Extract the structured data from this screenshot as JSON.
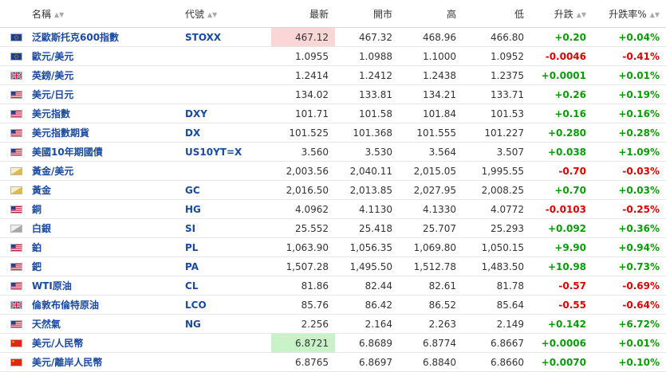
{
  "headers": {
    "name": "名稱",
    "code": "代號",
    "last": "最新",
    "open": "開市",
    "high": "高",
    "low": "低",
    "change": "升跌",
    "change_pct": "升跌率%"
  },
  "rows": [
    {
      "flag": "eu",
      "name": "泛歐斯托克600指數",
      "code": "STOXX",
      "last": "467.12",
      "open": "467.32",
      "high": "468.96",
      "low": "466.80",
      "change": "+0.20",
      "change_pct": "+0.04%",
      "dir": "up",
      "highlight": "red"
    },
    {
      "flag": "eu",
      "name": "歐元/美元",
      "code": "",
      "last": "1.0955",
      "open": "1.0988",
      "high": "1.1000",
      "low": "1.0952",
      "change": "-0.0046",
      "change_pct": "-0.41%",
      "dir": "down",
      "highlight": ""
    },
    {
      "flag": "uk",
      "name": "英鎊/美元",
      "code": "",
      "last": "1.2414",
      "open": "1.2412",
      "high": "1.2438",
      "low": "1.2375",
      "change": "+0.0001",
      "change_pct": "+0.01%",
      "dir": "up",
      "highlight": ""
    },
    {
      "flag": "us",
      "name": "美元/日元",
      "code": "",
      "last": "134.02",
      "open": "133.81",
      "high": "134.21",
      "low": "133.71",
      "change": "+0.26",
      "change_pct": "+0.19%",
      "dir": "up",
      "highlight": ""
    },
    {
      "flag": "us",
      "name": "美元指數",
      "code": "DXY",
      "last": "101.71",
      "open": "101.58",
      "high": "101.84",
      "low": "101.53",
      "change": "+0.16",
      "change_pct": "+0.16%",
      "dir": "up",
      "highlight": ""
    },
    {
      "flag": "us",
      "name": "美元指數期貨",
      "code": "DX",
      "last": "101.525",
      "open": "101.368",
      "high": "101.555",
      "low": "101.227",
      "change": "+0.280",
      "change_pct": "+0.28%",
      "dir": "up",
      "highlight": ""
    },
    {
      "flag": "us",
      "name": "美國10年期國債",
      "code": "US10YT=X",
      "last": "3.560",
      "open": "3.530",
      "high": "3.564",
      "low": "3.507",
      "change": "+0.038",
      "change_pct": "+1.09%",
      "dir": "up",
      "highlight": ""
    },
    {
      "flag": "gold",
      "name": "黃金/美元",
      "code": "",
      "last": "2,003.56",
      "open": "2,040.11",
      "high": "2,015.05",
      "low": "1,995.55",
      "change": "-0.70",
      "change_pct": "-0.03%",
      "dir": "down",
      "highlight": ""
    },
    {
      "flag": "gold",
      "name": "黃金",
      "code": "GC",
      "last": "2,016.50",
      "open": "2,013.85",
      "high": "2,027.95",
      "low": "2,008.25",
      "change": "+0.70",
      "change_pct": "+0.03%",
      "dir": "up",
      "highlight": ""
    },
    {
      "flag": "us",
      "name": "銅",
      "code": "HG",
      "last": "4.0962",
      "open": "4.1130",
      "high": "4.1330",
      "low": "4.0772",
      "change": "-0.0103",
      "change_pct": "-0.25%",
      "dir": "down",
      "highlight": ""
    },
    {
      "flag": "silver",
      "name": "白銀",
      "code": "SI",
      "last": "25.552",
      "open": "25.418",
      "high": "25.707",
      "low": "25.293",
      "change": "+0.092",
      "change_pct": "+0.36%",
      "dir": "up",
      "highlight": ""
    },
    {
      "flag": "us",
      "name": "鉑",
      "code": "PL",
      "last": "1,063.90",
      "open": "1,056.35",
      "high": "1,069.80",
      "low": "1,050.15",
      "change": "+9.90",
      "change_pct": "+0.94%",
      "dir": "up",
      "highlight": ""
    },
    {
      "flag": "us",
      "name": "鈀",
      "code": "PA",
      "last": "1,507.28",
      "open": "1,495.50",
      "high": "1,512.78",
      "low": "1,483.50",
      "change": "+10.98",
      "change_pct": "+0.73%",
      "dir": "up",
      "highlight": ""
    },
    {
      "flag": "us",
      "name": "WTI原油",
      "code": "CL",
      "last": "81.86",
      "open": "82.44",
      "high": "82.61",
      "low": "81.78",
      "change": "-0.57",
      "change_pct": "-0.69%",
      "dir": "down",
      "highlight": ""
    },
    {
      "flag": "uk",
      "name": "倫敦布倫特原油",
      "code": "LCO",
      "last": "85.76",
      "open": "86.42",
      "high": "86.52",
      "low": "85.64",
      "change": "-0.55",
      "change_pct": "-0.64%",
      "dir": "down",
      "highlight": ""
    },
    {
      "flag": "us",
      "name": "天然氣",
      "code": "NG",
      "last": "2.256",
      "open": "2.164",
      "high": "2.263",
      "low": "2.149",
      "change": "+0.142",
      "change_pct": "+6.72%",
      "dir": "up",
      "highlight": ""
    },
    {
      "flag": "cn",
      "name": "美元/人民幣",
      "code": "",
      "last": "6.8721",
      "open": "6.8689",
      "high": "6.8774",
      "low": "6.8667",
      "change": "+0.0006",
      "change_pct": "+0.01%",
      "dir": "up",
      "highlight": "green"
    },
    {
      "flag": "cn",
      "name": "美元/離岸人民幣",
      "code": "",
      "last": "6.8765",
      "open": "6.8697",
      "high": "6.8840",
      "low": "6.8660",
      "change": "+0.0070",
      "change_pct": "+0.10%",
      "dir": "up",
      "highlight": ""
    }
  ],
  "colors": {
    "link": "#1a4aa0",
    "up": "#0a9b0a",
    "down": "#dd0000",
    "highlight_red": "#fad6d6",
    "highlight_green": "#c9f2c9"
  },
  "icons": {
    "eu": "eu-flag-icon",
    "uk": "uk-flag-icon",
    "us": "us-flag-icon",
    "cn": "china-flag-icon",
    "gold": "gold-bar-icon",
    "silver": "silver-bar-icon",
    "sort": "sort-arrows-icon"
  }
}
